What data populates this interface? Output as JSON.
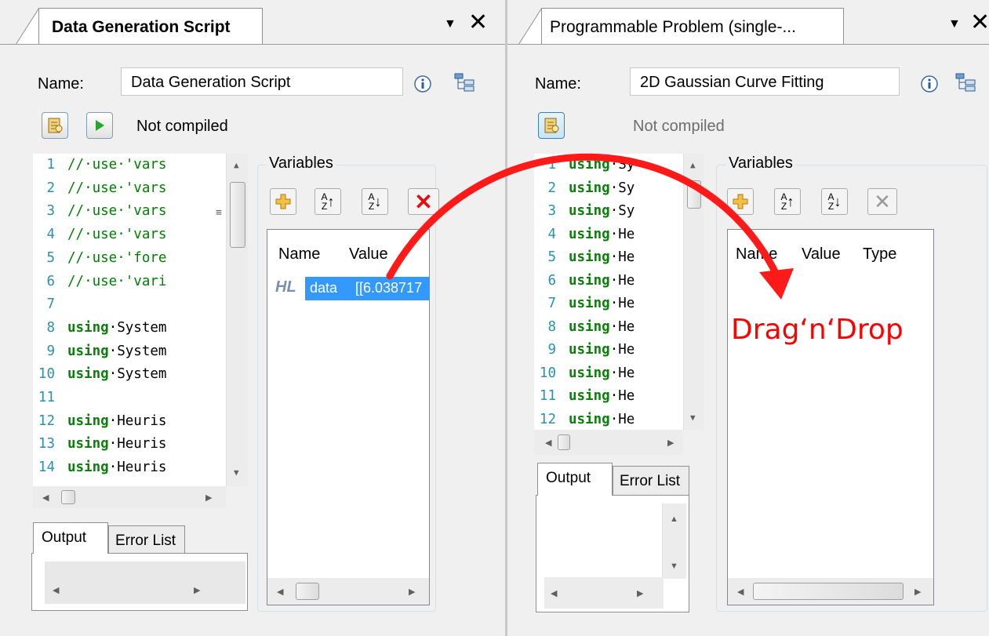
{
  "left_panel": {
    "tab_title": "Data Generation Script",
    "name_label": "Name:",
    "name_value": "Data Generation Script",
    "status": "Not compiled",
    "code_lines": [
      {
        "n": "1",
        "text": "//·use·'vars"
      },
      {
        "n": "2",
        "text": "//·use·'vars"
      },
      {
        "n": "3",
        "text": "//·use·'vars"
      },
      {
        "n": "4",
        "text": "//·use·'vars"
      },
      {
        "n": "5",
        "text": "//·use·'fore"
      },
      {
        "n": "6",
        "text": "//·use·'vari"
      },
      {
        "n": "7",
        "text": ""
      },
      {
        "n": "8",
        "text": "using·System"
      },
      {
        "n": "9",
        "text": "using·System"
      },
      {
        "n": "10",
        "text": "using·System"
      },
      {
        "n": "11",
        "text": ""
      },
      {
        "n": "12",
        "text": "using·Heuris"
      },
      {
        "n": "13",
        "text": "using·Heuris"
      },
      {
        "n": "14",
        "text": "using·Heuris"
      }
    ],
    "variables_title": "Variables",
    "col_name": "Name",
    "col_value": "Value",
    "var_icon": "HL",
    "var_name": "data",
    "var_value": "[[6.038717",
    "output_tab": "Output",
    "errorlist_tab": "Error List"
  },
  "right_panel": {
    "tab_title": "Programmable Problem (single-...",
    "name_label": "Name:",
    "name_value": "2D Gaussian Curve Fitting",
    "status": "Not compiled",
    "code_lines": [
      {
        "n": "1",
        "text": "using·Sy"
      },
      {
        "n": "2",
        "text": "using·Sy"
      },
      {
        "n": "3",
        "text": "using·Sy"
      },
      {
        "n": "4",
        "text": "using·He"
      },
      {
        "n": "5",
        "text": "using·He"
      },
      {
        "n": "6",
        "text": "using·He"
      },
      {
        "n": "7",
        "text": "using·He"
      },
      {
        "n": "8",
        "text": "using·He"
      },
      {
        "n": "9",
        "text": "using·He"
      },
      {
        "n": "10",
        "text": "using·He"
      },
      {
        "n": "11",
        "text": "using·He"
      },
      {
        "n": "12",
        "text": "using·He"
      }
    ],
    "variables_title": "Variables",
    "col_name": "Name",
    "col_value": "Value",
    "col_type": "Type",
    "output_tab": "Output",
    "errorlist_tab": "Error List"
  },
  "annotation": {
    "text": "Drag‘n‘Drop",
    "color": "#ff0000"
  },
  "colors": {
    "code_comment": "#008000",
    "line_number": "#2b91af",
    "selection": "#3399ff"
  }
}
